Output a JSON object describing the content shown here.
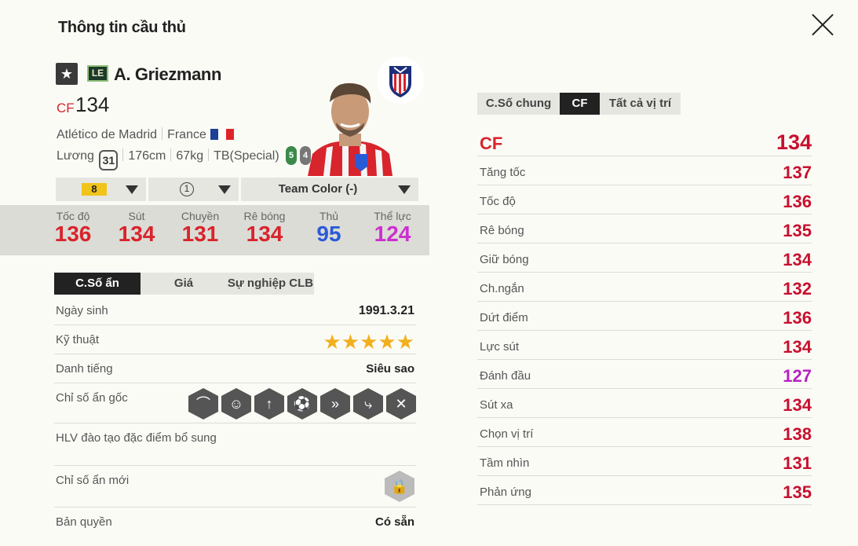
{
  "dialog": {
    "title": "Thông tin cầu thủ",
    "close_icon": "close-icon"
  },
  "player": {
    "star_badge": "★",
    "season_code": "LE",
    "name": "A. Griezmann",
    "position": "CF",
    "overall": "134",
    "club": "Atlético de Madrid",
    "nationality": "France",
    "flag_colors": [
      "#1d3f96",
      "#ffffff",
      "#e0232b"
    ],
    "wage_label": "Lương",
    "wage": "31",
    "height": "176cm",
    "weight": "67kg",
    "body_type": "TB(Special)",
    "strong_foot": "5",
    "weak_foot": "4"
  },
  "selectors": {
    "level": "8",
    "team_color_rank": "1",
    "team_color": "Team Color (-)"
  },
  "summary_stats": [
    {
      "label": "Tốc độ",
      "value": "136",
      "color": "#d8242c"
    },
    {
      "label": "Sút",
      "value": "134",
      "color": "#d8242c"
    },
    {
      "label": "Chuyền",
      "value": "131",
      "color": "#d8242c"
    },
    {
      "label": "Rê bóng",
      "value": "134",
      "color": "#d8242c"
    },
    {
      "label": "Thủ",
      "value": "95",
      "color": "#2a5bd7"
    },
    {
      "label": "Thể lực",
      "value": "124",
      "color": "#cc2fcf"
    }
  ],
  "left_tabs": [
    "C.Số ẩn",
    "Giá",
    "Sự nghiệp CLB"
  ],
  "details": {
    "birth_label": "Ngày sinh",
    "birth_value": "1991.3.21",
    "skill_label": "Kỹ thuật",
    "skill_stars": "★★★★★",
    "fame_label": "Danh tiếng",
    "fame_value": "Siêu sao",
    "traits_label": "Chỉ số ẩn gốc",
    "coach_label": "HLV đào tạo đặc điểm bổ sung",
    "new_traits_label": "Chỉ số ẩn mới",
    "license_label": "Bản quyền",
    "license_value": "Có sẵn"
  },
  "right_tabs": [
    "C.Số chung",
    "CF",
    "Tất cả vị trí"
  ],
  "position_stats": [
    {
      "label": "CF",
      "value": "134",
      "color": "#c8102e"
    },
    {
      "label": "Tăng tốc",
      "value": "137",
      "color": "#c8102e"
    },
    {
      "label": "Tốc độ",
      "value": "136",
      "color": "#c8102e"
    },
    {
      "label": "Rê bóng",
      "value": "135",
      "color": "#c8102e"
    },
    {
      "label": "Giữ bóng",
      "value": "134",
      "color": "#c8102e"
    },
    {
      "label": "Ch.ngắn",
      "value": "132",
      "color": "#c8102e"
    },
    {
      "label": "Dứt điểm",
      "value": "136",
      "color": "#c8102e"
    },
    {
      "label": "Lực sút",
      "value": "134",
      "color": "#c8102e"
    },
    {
      "label": "Đánh đầu",
      "value": "127",
      "color": "#b622c2"
    },
    {
      "label": "Sút xa",
      "value": "134",
      "color": "#c8102e"
    },
    {
      "label": "Chọn vị trí",
      "value": "138",
      "color": "#c8102e"
    },
    {
      "label": "Tầm nhìn",
      "value": "131",
      "color": "#c8102e"
    },
    {
      "label": "Phản ứng",
      "value": "135",
      "color": "#c8102e"
    }
  ]
}
